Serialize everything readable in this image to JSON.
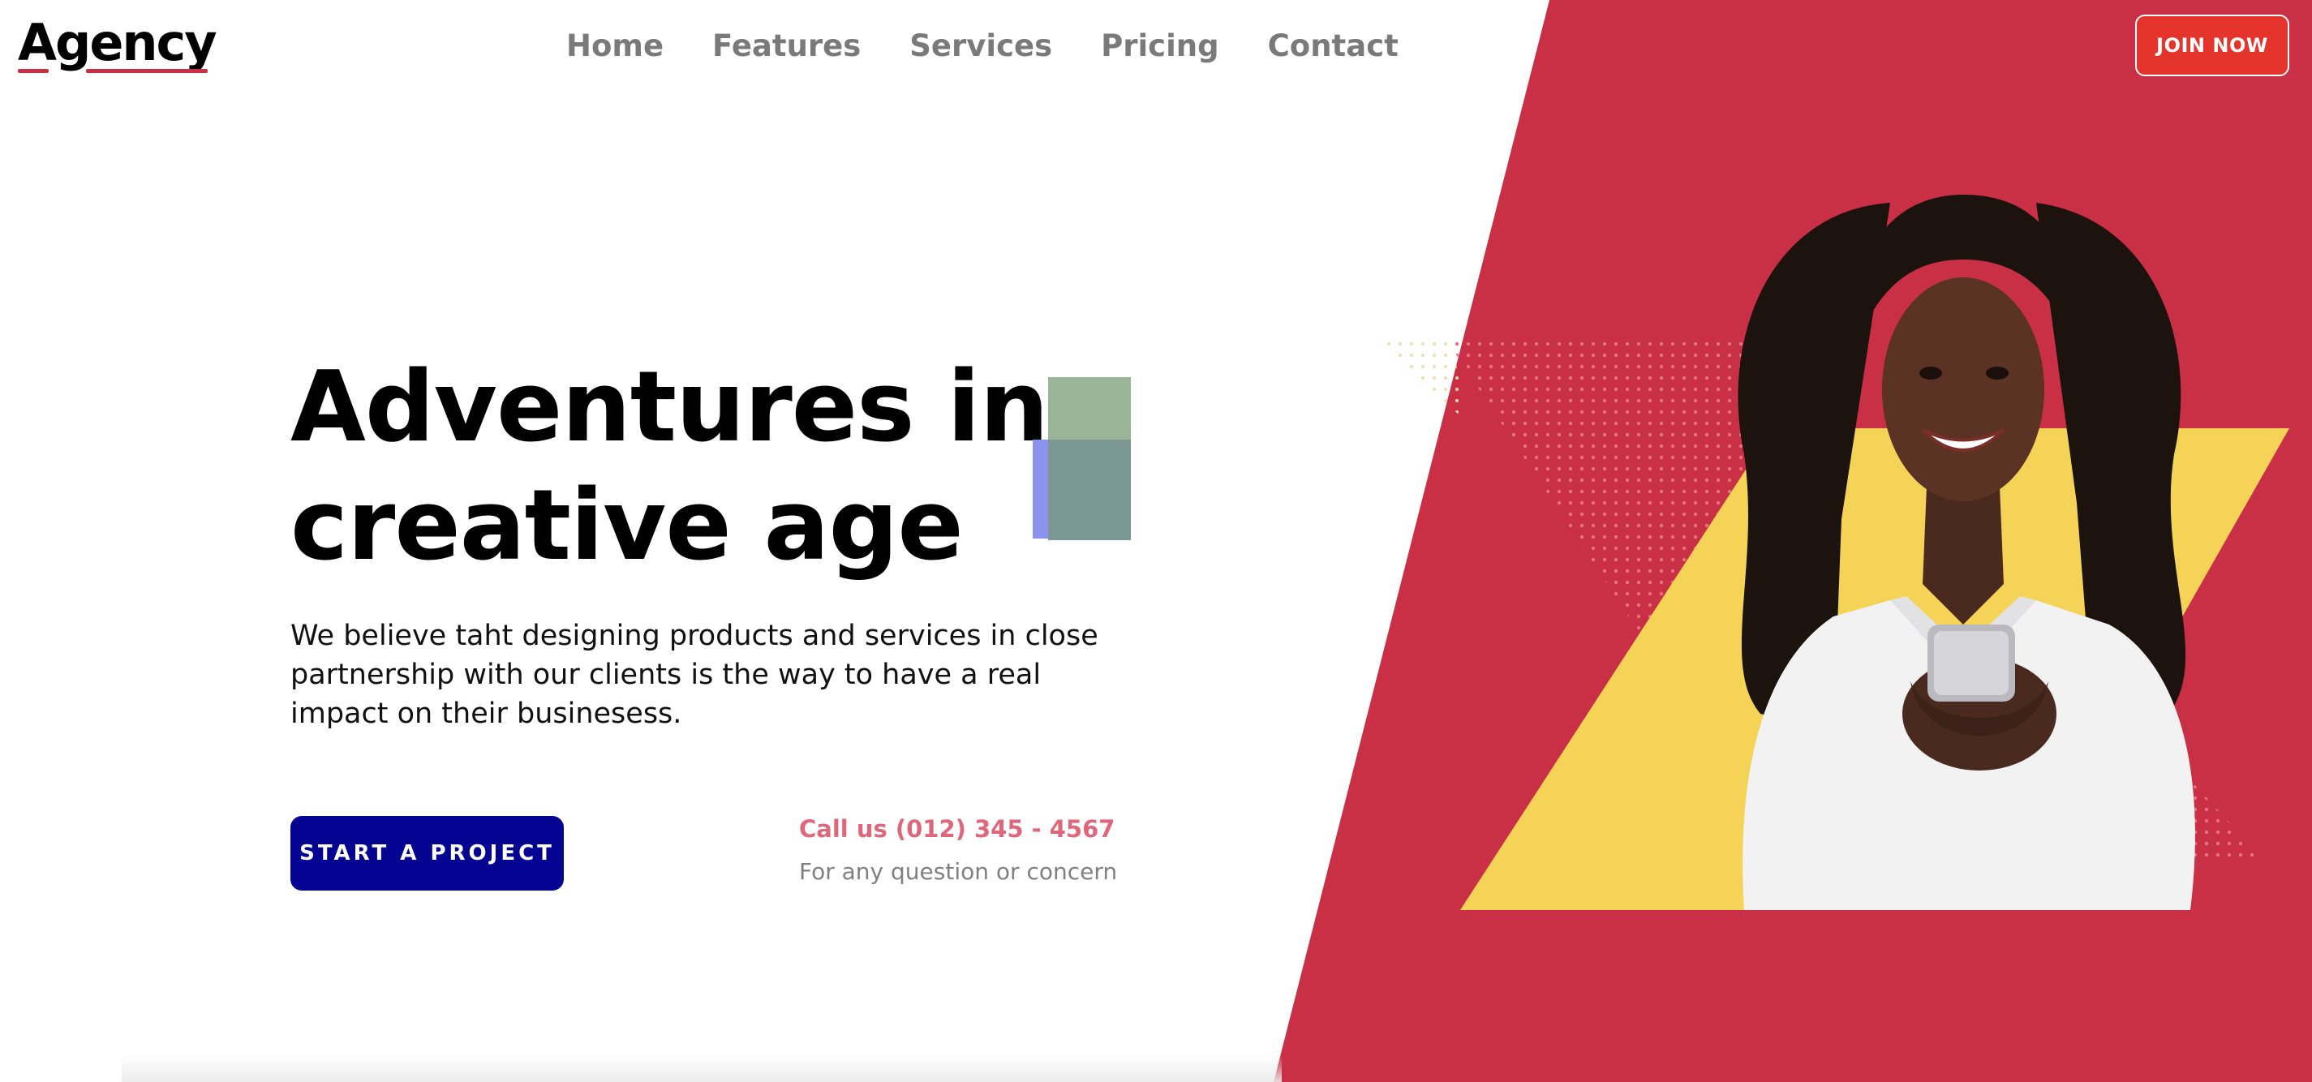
{
  "header": {
    "logo": "Agency",
    "nav": [
      "Home",
      "Features",
      "Services",
      "Pricing",
      "Contact"
    ],
    "join_label": "JOIN NOW"
  },
  "hero": {
    "headline_line1": "Adventures in",
    "headline_line2": "creative age",
    "lead": "We believe taht designing products and services in close partnership with our clients is the way to have a real impact on their businesess.",
    "cta_label": "START A PROJECT",
    "call_label": "Call us (012) 345 - 4567",
    "call_sub": "For any question or concern"
  },
  "colors": {
    "panel_red": "#c93045",
    "accent_yellow": "#f4d357",
    "cta_navy": "#050392",
    "join_red": "#e5342b",
    "call_pink": "#e0677b"
  },
  "icons": {
    "hero_photo": "smiling-woman-holding-phone-illustration"
  }
}
